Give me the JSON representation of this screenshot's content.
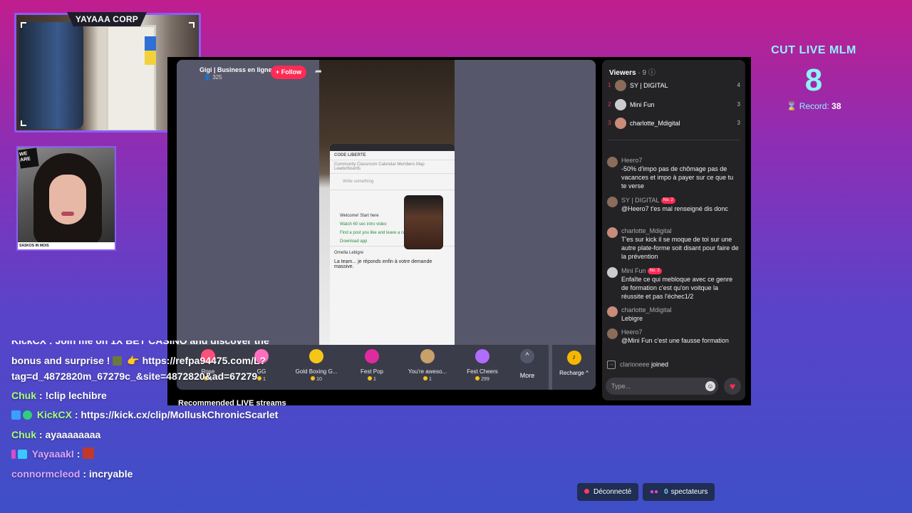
{
  "overlay": {
    "corp_tag": "YAYAAA CORP",
    "cam_logo": "WE ARE",
    "cam_caption": "SASKOS IN MOIS",
    "counter": {
      "title": "CUT LIVE MLM",
      "value": "8",
      "record_label": "Record:",
      "record_value": "38"
    }
  },
  "live": {
    "streamer_name": "Gigi | Business en ligne ...",
    "viewer_count": "325",
    "follow_label": "+ Follow",
    "gifts": [
      {
        "name": "Rose",
        "price": "1",
        "color": "#ff4f7b"
      },
      {
        "name": "GG",
        "price": "1",
        "color": "#ff6fbf"
      },
      {
        "name": "Gold Boxing G...",
        "price": "10",
        "color": "#f5c518"
      },
      {
        "name": "Fest Pop",
        "price": "1",
        "color": "#e02aa0"
      },
      {
        "name": "You're aweso...",
        "price": "1",
        "color": "#c8a06a"
      },
      {
        "name": "Fest Cheers",
        "price": "299",
        "color": "#b06bff"
      }
    ],
    "more_label": "More",
    "recharge_label": "Recharge",
    "recommended_label": "Recommended LIVE streams",
    "phone": {
      "group_name": "CODE LIBERTE",
      "tabs": "Community  Classroom  Calendar  Members  Map  Leaderboards",
      "write": "Write something",
      "welcome": "Welcome! Start here",
      "task1": "Watch 60 sec intro video",
      "task2": "Find a post you like and leave a comment",
      "task3": "Download app",
      "poster": "Ornella Lebigre",
      "post": "La team... je réponds enfin à votre demande massive."
    }
  },
  "viewers": {
    "title": "Viewers",
    "count": "· 9",
    "list": [
      {
        "rank": "1",
        "name": "SY | DIGITAL",
        "count": "4",
        "color": "#8b6b5a"
      },
      {
        "rank": "2",
        "name": "Mini Fun",
        "count": "3",
        "color": "#cccccc"
      },
      {
        "rank": "3",
        "name": "charlotte_Mdigital",
        "count": "3",
        "color": "#c98b7a"
      }
    ]
  },
  "chat": {
    "messages": [
      {
        "user": "Heero7",
        "badge": "",
        "text": "-50% d'impo pas de chômage pas de vacances et impo à payer sur ce que tu te verse"
      },
      {
        "user": "SY | DIGITAL",
        "badge": "No. 2",
        "text": "@Heero7 t'es mal renseigné dis donc"
      },
      {
        "user": "charlotte_Mdigital",
        "badge": "",
        "text": "T'es sur kick il se moque de toi sur une autre plate-forme soit disant pour faire de la prévention"
      },
      {
        "user": "Mini Fun",
        "badge": "No. 2",
        "text": "Enfaîte ce qui mebloque avec ce genre de formation c'est qu'on voitque la réussite et pas l'échec1/2"
      },
      {
        "user": "charlotte_Mdigital",
        "badge": "",
        "text": "Lebigre"
      },
      {
        "user": "Heero7",
        "badge": "",
        "text": "@Mini Fun c'est une fausse formation"
      }
    ],
    "joined_user": "clarioneee",
    "joined_text": "joined",
    "input_placeholder": "Type..."
  },
  "overlay_chat": {
    "clipped": "KickCX : Join me on 1X BET CASINO and discover the",
    "line1": "bonus and surprise !",
    "line1_link": "https://refpa94475.com/L?",
    "line2": "tag=d_4872820m_67279c_&site=4872820&ad=67279",
    "messages": [
      {
        "user": "Chuk",
        "text": ": !clip lechibre",
        "color": "#a8ff7a"
      },
      {
        "user": "KickCX",
        "text": ": https://kick.cx/clip/MolluskChronicScarlet",
        "color": "#a8ff7a"
      },
      {
        "user": "Chuk",
        "text": ": ayaaaaaaaa",
        "color": "#a8ff7a"
      },
      {
        "user": "YayaaakI",
        "text": ":",
        "color": "#d9a8ff"
      },
      {
        "user": "connormcleod",
        "text": ": incryable",
        "color": "#d9a8ff"
      }
    ]
  },
  "status": {
    "disconnected": "Déconnecté",
    "spectators_count": "0",
    "spectators_label": "spectateurs"
  }
}
